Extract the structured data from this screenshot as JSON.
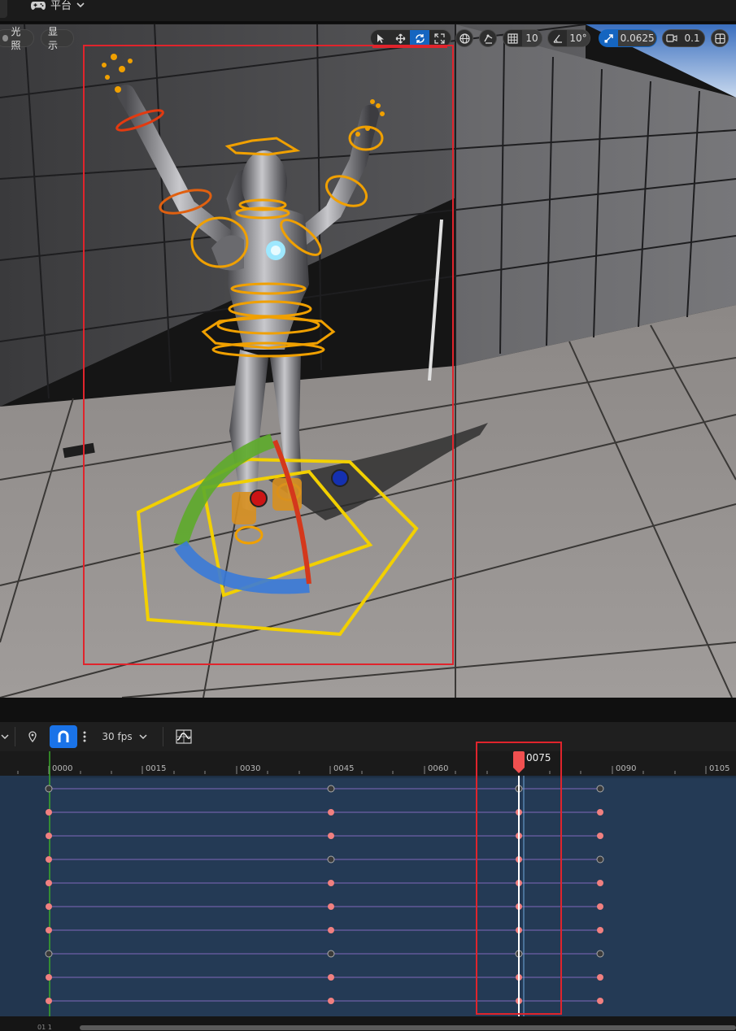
{
  "top": {
    "platform_label": "平台"
  },
  "viewport": {
    "left_pills": [
      {
        "label": "光照"
      },
      {
        "label": "显示"
      }
    ],
    "toolbar": {
      "grid_snap_value": "10",
      "rotation_snap_value": "10°",
      "scale_snap_value": "0.0625",
      "camera_speed_value": "0.1"
    }
  },
  "sequencer": {
    "fps_label": "30 fps",
    "current_frame": "0075",
    "ruler_labels": [
      "0000",
      "0015",
      "0030",
      "0045",
      "0060",
      "0090",
      "0105"
    ],
    "bottom_small": "01 1"
  },
  "colors": {
    "selection": "#e0242c",
    "accent_blue": "#1a73e8",
    "key_red": "#f08080",
    "key_gray": "#3a3a3a",
    "track_bg": "#243a55"
  }
}
